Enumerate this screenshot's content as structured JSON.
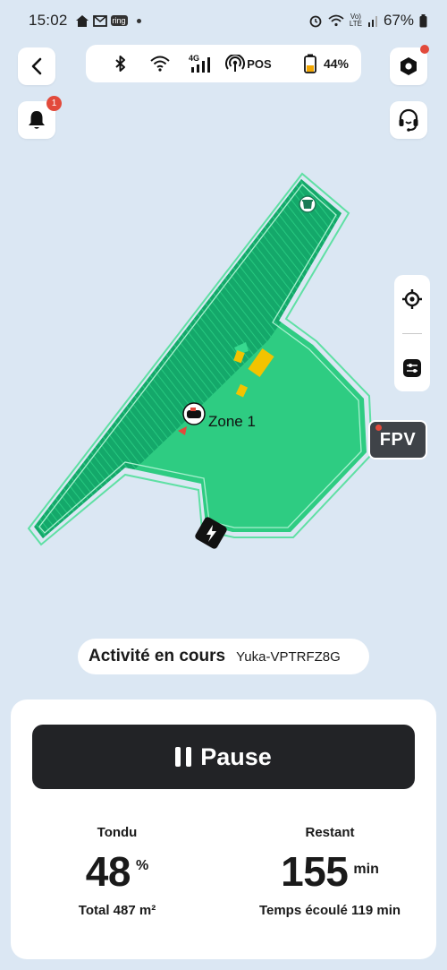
{
  "status_bar": {
    "time": "15:02",
    "ring_label": "ring",
    "volte_label": "Vo)",
    "lte_label": "LTE",
    "battery_percent": "67%"
  },
  "device_status": {
    "pos_label": "POS",
    "battery_label": "44%",
    "battery_level": 0.44
  },
  "notifications": {
    "badge_count": "1"
  },
  "map": {
    "zone_label": "Zone 1"
  },
  "fpv": {
    "label": "FPV"
  },
  "activity": {
    "title": "Activité en cours",
    "device_name": "Yuka-VPTRFZ8G"
  },
  "controls": {
    "pause_label": "Pause"
  },
  "stats": {
    "mowed": {
      "label": "Tondu",
      "value": "48",
      "unit": "%",
      "sub": "Total 487 m²"
    },
    "remaining": {
      "label": "Restant",
      "value": "155",
      "unit": "min",
      "sub": "Temps écoulé 119 min"
    }
  },
  "colors": {
    "background": "#dbe7f3",
    "lawn": "#2ecc82",
    "lawn_mowed": "#14a86a",
    "obstacle": "#f2c300",
    "alert": "#e24a3b"
  }
}
